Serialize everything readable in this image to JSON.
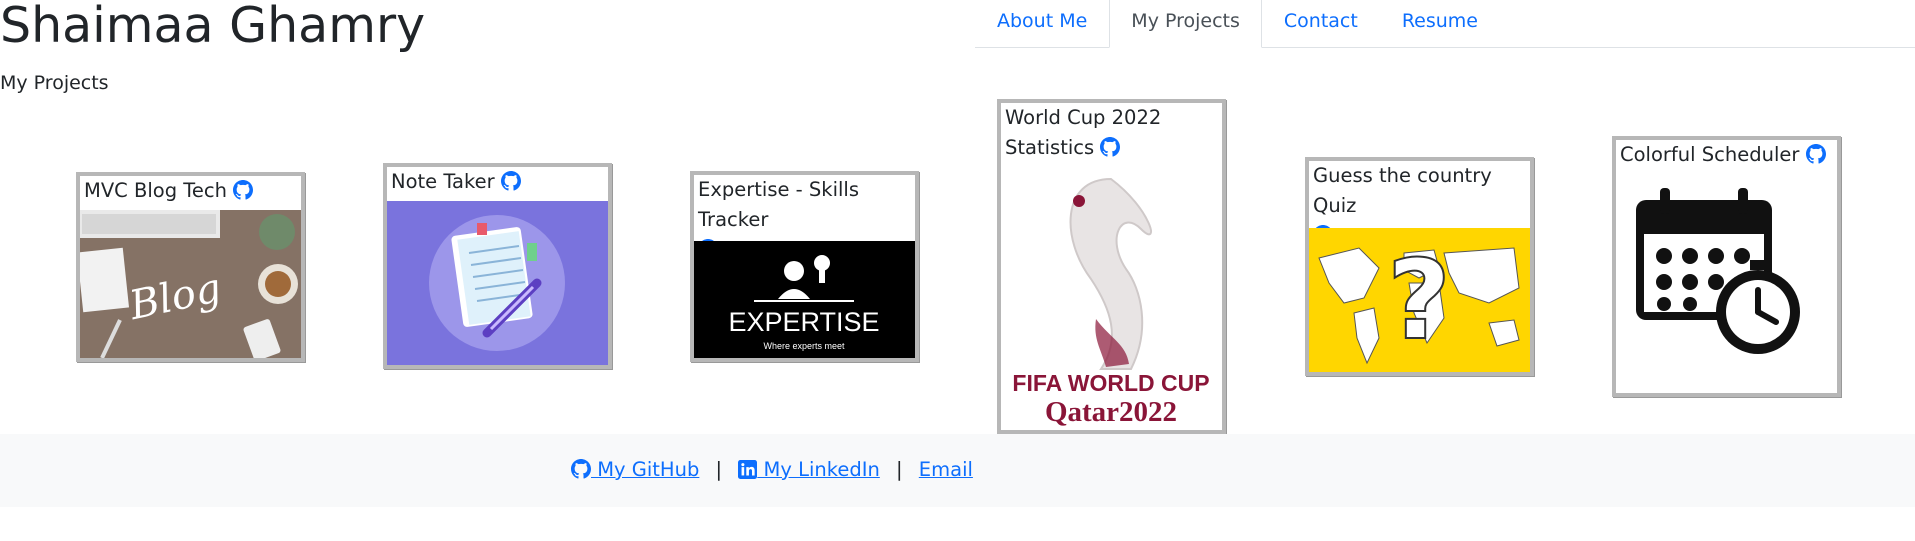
{
  "header": {
    "title": "Shaimaa Ghamry",
    "subtitle": "My Projects"
  },
  "nav": {
    "tabs": [
      {
        "label": "About Me",
        "active": false
      },
      {
        "label": "My Projects",
        "active": true
      },
      {
        "label": "Contact",
        "active": false
      },
      {
        "label": "Resume",
        "active": false
      }
    ]
  },
  "projects": [
    {
      "title": "MVC Blog Tech",
      "image_text": "Blog",
      "icon": "github-icon"
    },
    {
      "title": "Note Taker",
      "icon": "github-icon"
    },
    {
      "title": "Expertise - Skills Tracker",
      "image_text": "EXPERTISE",
      "image_subtext": "Where experts meet",
      "icon": "github-icon"
    },
    {
      "title": "World Cup 2022 Statistics",
      "image_text": "FIFA WORLD CUP",
      "image_subtext": "Qatar2022",
      "icon": "github-icon"
    },
    {
      "title": "Guess the country Quiz",
      "icon": "github-icon"
    },
    {
      "title": "Colorful Scheduler",
      "icon": "github-icon"
    }
  ],
  "footer": {
    "github_label": " My GitHub",
    "linkedin_label": " My LinkedIn",
    "email_label": "Email",
    "separator": "|"
  },
  "colors": {
    "link": "#0d6efd",
    "footer_bg": "#f8f9fa",
    "note_bg": "#7a73dd",
    "quiz_bg": "#ffd600",
    "fifa_red": "#8a1538"
  }
}
